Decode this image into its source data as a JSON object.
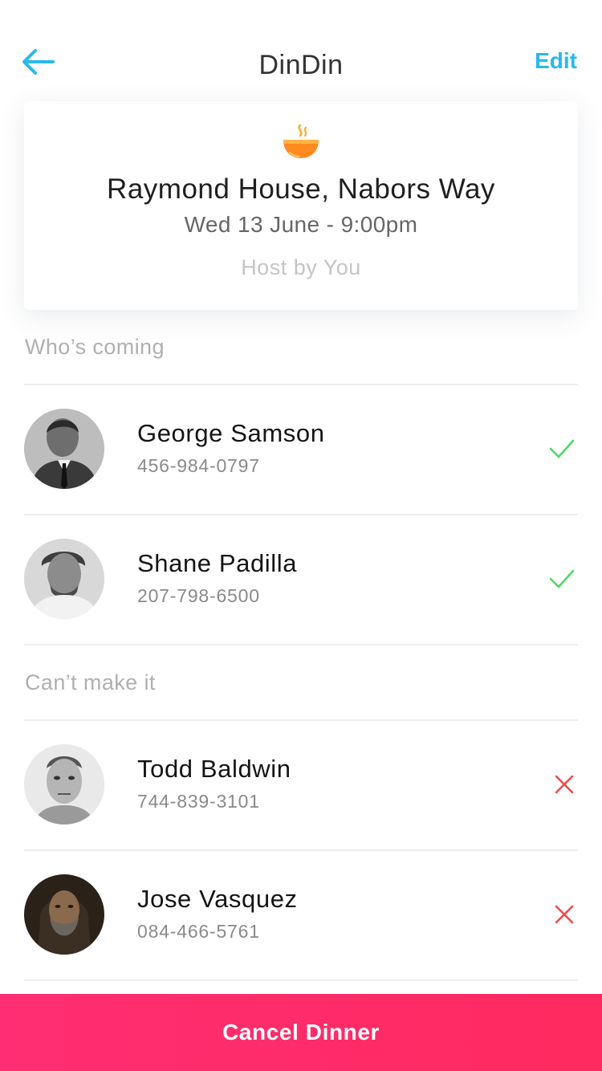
{
  "nav": {
    "title": "DinDin",
    "edit_label": "Edit",
    "accent_color": "#29b8ec"
  },
  "event": {
    "icon": "bowl-icon",
    "place": "Raymond House, Nabors Way",
    "datetime": "Wed 13 June - 9:00pm",
    "host": "Host by You"
  },
  "sections": {
    "coming_label": "Who’s coming",
    "declined_label": "Can’t make it"
  },
  "coming": [
    {
      "name": "George Samson",
      "phone": "456-984-0797",
      "status": "accepted",
      "status_icon": "checkmark-icon"
    },
    {
      "name": "Shane Padilla",
      "phone": "207-798-6500",
      "status": "accepted",
      "status_icon": "checkmark-icon"
    }
  ],
  "declined": [
    {
      "name": "Todd Baldwin",
      "phone": "744-839-3101",
      "status": "declined",
      "status_icon": "cross-icon"
    },
    {
      "name": "Jose Vasquez",
      "phone": "084-466-5761",
      "status": "declined",
      "status_icon": "cross-icon"
    }
  ],
  "status_colors": {
    "accepted": "#4cd964",
    "declined": "#f24949"
  },
  "footer": {
    "cancel_label": "Cancel Dinner",
    "button_color": "#ff2d6e"
  }
}
